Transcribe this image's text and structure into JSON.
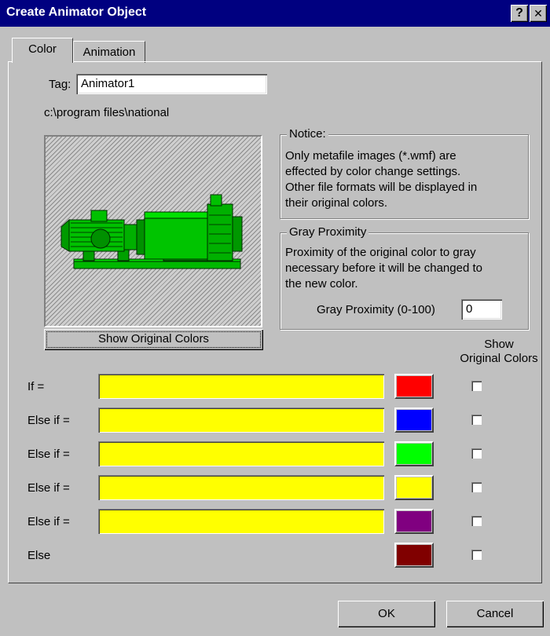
{
  "window": {
    "title": "Create Animator Object",
    "help_label": "?",
    "close_label": "✕"
  },
  "tabs": [
    {
      "label": "Color",
      "active": true
    },
    {
      "label": "Animation",
      "active": false
    }
  ],
  "tag": {
    "label": "Tag:",
    "value": "Animator1"
  },
  "path_text": "c:\\program files\\national",
  "preview": {
    "icon": "motor-pump-image",
    "button_label": "Show Original Colors"
  },
  "notice": {
    "legend": "Notice:",
    "lines": [
      "Only metafile images (*.wmf) are",
      "effected by color change settings.",
      "Other file formats will be displayed in",
      "their original colors."
    ]
  },
  "gray_proximity": {
    "legend": "Gray Proximity",
    "lines": [
      "Proximity of the original color to gray",
      "necessary before it will be changed to",
      "the new color."
    ],
    "field_label": "Gray Proximity (0-100)",
    "value": "0"
  },
  "show_original_header": [
    "Show",
    "Original Colors"
  ],
  "conditions": [
    {
      "label": "If =",
      "expression": "",
      "color": "#ff0000",
      "show_original": false
    },
    {
      "label": "Else if =",
      "expression": "",
      "color": "#0000ff",
      "show_original": false
    },
    {
      "label": "Else if =",
      "expression": "",
      "color": "#00ff00",
      "show_original": false
    },
    {
      "label": "Else if =",
      "expression": "",
      "color": "#ffff00",
      "show_original": false
    },
    {
      "label": "Else if =",
      "expression": "",
      "color": "#800080",
      "show_original": false
    },
    {
      "label": "Else",
      "expression": null,
      "color": "#800000",
      "show_original": false
    }
  ],
  "buttons": {
    "ok": "OK",
    "cancel": "Cancel"
  }
}
